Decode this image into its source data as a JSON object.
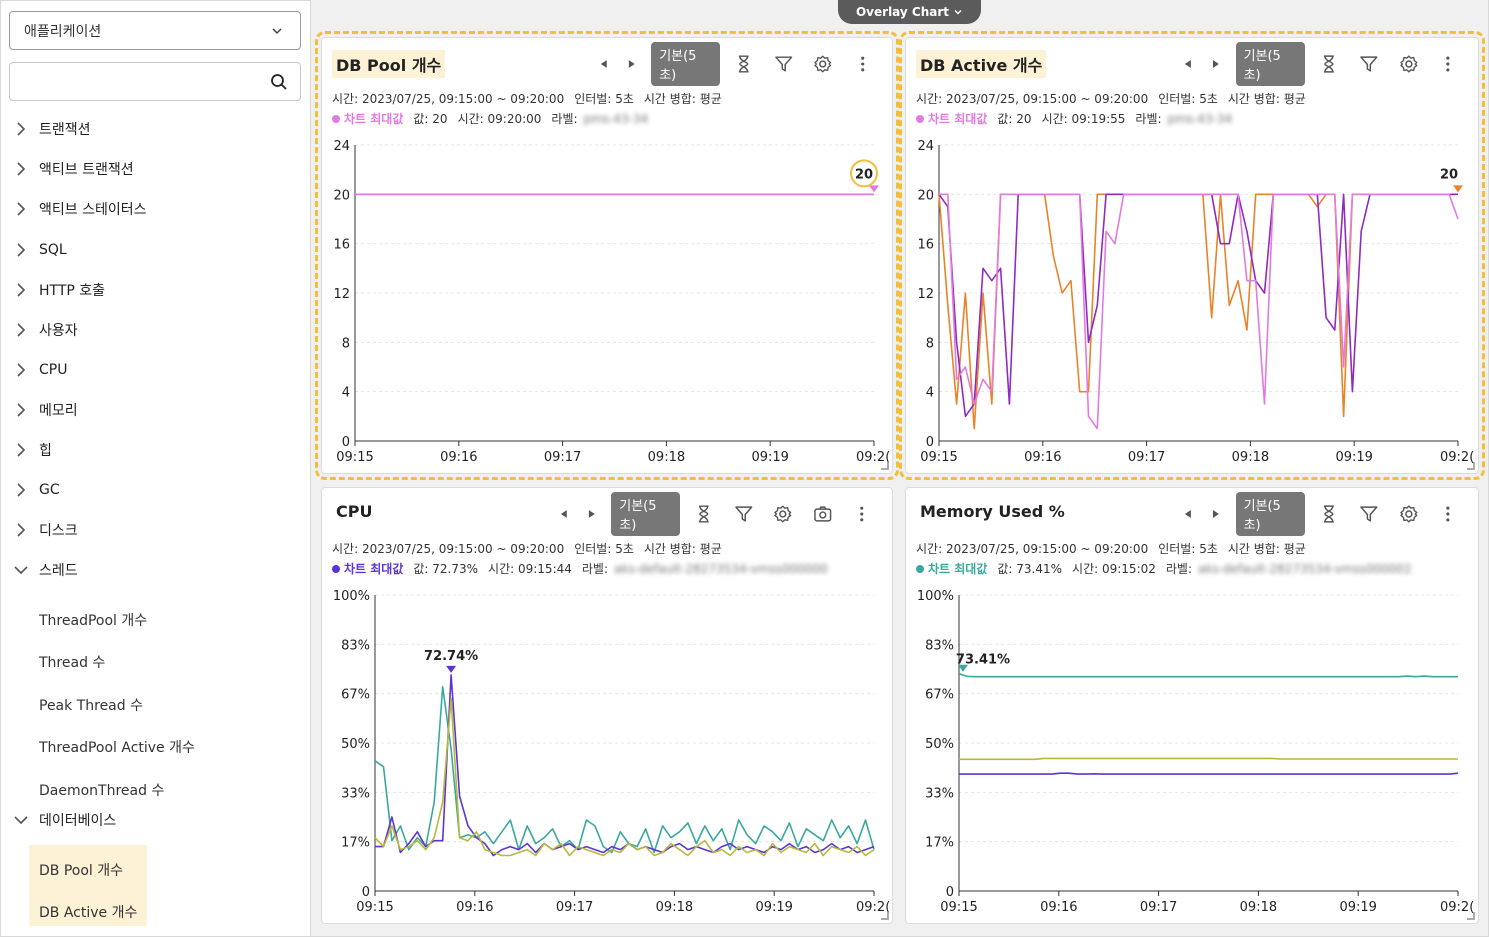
{
  "sidebar": {
    "app_select": "애플리케이션",
    "search_placeholder": "",
    "tree": [
      {
        "label": "트랜잭션",
        "expanded": false
      },
      {
        "label": "액티브 트랜잭션",
        "expanded": false
      },
      {
        "label": "액티브 스테이터스",
        "expanded": false
      },
      {
        "label": "SQL",
        "expanded": false
      },
      {
        "label": "HTTP 호출",
        "expanded": false
      },
      {
        "label": "사용자",
        "expanded": false
      },
      {
        "label": "CPU",
        "expanded": false
      },
      {
        "label": "메모리",
        "expanded": false
      },
      {
        "label": "힙",
        "expanded": false
      },
      {
        "label": "GC",
        "expanded": false
      },
      {
        "label": "디스크",
        "expanded": false
      },
      {
        "label": "스레드",
        "expanded": true
      },
      {
        "label": "데이터베이스",
        "expanded": true
      }
    ],
    "thread_children": [
      "ThreadPool 개수",
      "Thread 수",
      "Peak Thread 수",
      "ThreadPool Active 개수",
      "DaemonThread 수"
    ],
    "db_children": [
      "DB Pool 개수",
      "DB Active 개수"
    ]
  },
  "overlay_tab": "Overlay Chart",
  "colors": {
    "pink": "#e27be0",
    "purple": "#8e2cc2",
    "orange": "#e8832a",
    "indigo": "#5b34d6",
    "teal": "#3aa89f",
    "olive": "#b8b93a",
    "highlight": "#fdf1d6",
    "dash": "#f2bf3c"
  },
  "panels": [
    {
      "title": "DB Pool 개수",
      "badge": "기본(5초)",
      "info_time": "시간: 2023/07/25, 09:15:00 ~ 09:20:00",
      "info_interval": "인터벌: 5초",
      "info_merge": "시간 병합: 평균",
      "max_label": "차트 최대값",
      "max_value": "값: 20",
      "max_time": "시간: 09:20:00",
      "label_key": "라벨:",
      "label_val": "pms-43-34",
      "peak_text": "20"
    },
    {
      "title": "DB Active 개수",
      "badge": "기본(5초)",
      "info_time": "시간: 2023/07/25, 09:15:00 ~ 09:20:00",
      "info_interval": "인터벌: 5초",
      "info_merge": "시간 병합: 평균",
      "max_label": "차트 최대값",
      "max_value": "값: 20",
      "max_time": "시간: 09:19:55",
      "label_key": "라벨:",
      "label_val": "pms-43-34",
      "peak_text": "20"
    },
    {
      "title": "CPU",
      "badge": "기본(5초)",
      "info_time": "시간: 2023/07/25, 09:15:00 ~ 09:20:00",
      "info_interval": "인터벌: 5초",
      "info_merge": "시간 병합: 평균",
      "max_label": "차트 최대값",
      "max_value": "값: 72.73%",
      "max_time": "시간: 09:15:44",
      "label_key": "라벨:",
      "label_val": "aks-default-28273534-vmss000000",
      "peak_text": "72.74%"
    },
    {
      "title": "Memory Used %",
      "badge": "기본(5초)",
      "info_time": "시간: 2023/07/25, 09:15:00 ~ 09:20:00",
      "info_interval": "인터벌: 5초",
      "info_merge": "시간 병합: 평균",
      "max_label": "차트 최대값",
      "max_value": "값: 73.41%",
      "max_time": "시간: 09:15:02",
      "label_key": "라벨:",
      "label_val": "aks-default-28273534-vmss000002",
      "peak_text": "73.41%"
    }
  ],
  "chart_data": [
    {
      "type": "line",
      "x_ticks": [
        "09:15",
        "09:16",
        "09:17",
        "09:18",
        "09:19",
        "09:2("
      ],
      "y_ticks": [
        "0",
        "4",
        "8",
        "12",
        "16",
        "20",
        "24"
      ],
      "ylim": [
        0,
        24
      ],
      "series": [
        {
          "color": "#8e2cc2",
          "values": [
            20,
            20,
            20,
            20,
            20,
            20,
            20,
            20,
            20,
            20,
            20,
            20,
            20
          ]
        },
        {
          "color": "#e27be0",
          "values": [
            20,
            20,
            20,
            20,
            20,
            20,
            20,
            20,
            20,
            20,
            20,
            20,
            20
          ]
        }
      ]
    },
    {
      "type": "line",
      "x_ticks": [
        "09:15",
        "09:16",
        "09:17",
        "09:18",
        "09:19",
        "09:2("
      ],
      "y_ticks": [
        "0",
        "4",
        "8",
        "12",
        "16",
        "20",
        "24"
      ],
      "ylim": [
        0,
        24
      ],
      "series": [
        {
          "color": "#e8832a",
          "values": [
            20,
            11,
            3,
            12,
            1,
            12,
            3,
            20,
            20,
            20,
            20,
            20,
            20,
            15,
            12,
            13,
            4,
            4,
            20,
            20,
            20,
            20,
            20,
            20,
            20,
            20,
            20,
            20,
            20,
            20,
            20,
            10,
            20,
            11,
            13,
            9,
            20,
            20,
            20,
            20,
            20,
            20,
            20,
            19,
            20,
            20,
            2,
            20,
            20,
            20,
            20,
            20,
            20,
            20,
            20,
            20,
            20,
            20,
            20,
            20
          ]
        },
        {
          "color": "#8e2cc2",
          "values": [
            20,
            19,
            8,
            2,
            3,
            14,
            13,
            14,
            3,
            20,
            20,
            20,
            20,
            20,
            20,
            20,
            20,
            8,
            11,
            20,
            20,
            20,
            20,
            20,
            20,
            20,
            20,
            20,
            20,
            20,
            20,
            20,
            16,
            16,
            20,
            17,
            13,
            12,
            20,
            20,
            20,
            20,
            20,
            20,
            10,
            9,
            20,
            4,
            17,
            20,
            20,
            20,
            20,
            20,
            20,
            20,
            20,
            20,
            20,
            20
          ]
        },
        {
          "color": "#e27be0",
          "values": [
            20,
            20,
            5,
            6,
            3,
            5,
            4,
            20,
            20,
            20,
            20,
            20,
            20,
            20,
            20,
            20,
            20,
            2,
            1,
            17,
            16,
            20,
            20,
            20,
            20,
            20,
            20,
            20,
            20,
            20,
            20,
            20,
            20,
            20,
            20,
            13,
            13,
            3,
            20,
            20,
            20,
            20,
            20,
            20,
            20,
            20,
            6,
            20,
            20,
            20,
            20,
            20,
            20,
            20,
            20,
            20,
            20,
            20,
            20,
            18
          ]
        }
      ]
    },
    {
      "type": "line",
      "x_ticks": [
        "09:15",
        "09:16",
        "09:17",
        "09:18",
        "09:19",
        "09:2("
      ],
      "y_ticks": [
        "0",
        "17%",
        "33%",
        "50%",
        "67%",
        "83%",
        "100%"
      ],
      "ylim": [
        0,
        100
      ],
      "series": [
        {
          "color": "#3aa89f",
          "values": [
            44,
            42,
            17,
            22,
            14,
            18,
            15,
            30,
            69,
            48,
            18,
            19,
            18,
            20,
            16,
            20,
            24,
            14,
            22,
            16,
            18,
            21,
            15,
            17,
            14,
            24,
            22,
            15,
            13,
            20,
            16,
            15,
            21,
            13,
            22,
            18,
            20,
            23,
            16,
            22,
            17,
            21,
            14,
            24,
            19,
            16,
            22,
            20,
            17,
            23,
            15,
            21,
            19,
            17,
            24,
            18,
            22,
            16,
            24,
            14
          ]
        },
        {
          "color": "#5b34d6",
          "values": [
            15,
            15,
            25,
            13,
            16,
            20,
            15,
            17,
            17,
            73,
            32,
            22,
            18,
            16,
            12,
            14,
            15,
            14,
            16,
            13,
            16,
            14,
            15,
            16,
            14,
            15,
            14,
            13,
            15,
            14,
            16,
            14,
            15,
            14,
            13,
            15,
            16,
            14,
            15,
            14,
            13,
            15,
            16,
            14,
            15,
            14,
            13,
            15,
            14,
            16,
            14,
            15,
            13,
            14,
            16,
            14,
            15,
            13,
            14,
            15
          ]
        },
        {
          "color": "#b8b93a",
          "values": [
            18,
            15,
            22,
            14,
            15,
            17,
            14,
            18,
            30,
            65,
            18,
            17,
            20,
            14,
            13,
            12,
            12,
            13,
            14,
            12,
            16,
            14,
            16,
            12,
            15,
            14,
            13,
            12,
            14,
            13,
            16,
            14,
            15,
            12,
            13,
            16,
            14,
            12,
            15,
            17,
            13,
            14,
            12,
            15,
            13,
            14,
            12,
            16,
            13,
            15,
            14,
            13,
            16,
            12,
            15,
            14,
            13,
            15,
            12,
            14
          ]
        }
      ]
    },
    {
      "type": "line",
      "x_ticks": [
        "09:15",
        "09:16",
        "09:17",
        "09:18",
        "09:19",
        "09:2("
      ],
      "y_ticks": [
        "0",
        "17%",
        "33%",
        "50%",
        "67%",
        "83%",
        "100%"
      ],
      "ylim": [
        0,
        100
      ],
      "series": [
        {
          "color": "#3aa89f",
          "values": [
            73.41,
            72.5,
            72.4,
            72.4,
            72.4,
            72.4,
            72.4,
            72.4,
            72.4,
            72.4,
            72.4,
            72.4,
            72.4,
            72.4,
            72.4,
            72.4,
            72.4,
            72.4,
            72.4,
            72.4,
            72.4,
            72.4,
            72.4,
            72.4,
            72.4,
            72.4,
            72.4,
            72.4,
            72.4,
            72.4,
            72.4,
            72.4,
            72.4,
            72.4,
            72.4,
            72.4,
            72.4,
            72.4,
            72.4,
            72.4,
            72.4,
            72.4,
            72.4,
            72.4,
            72.4,
            72.4,
            72.4,
            72.4,
            72.4,
            72.4,
            72.4,
            72.4,
            72.4,
            72.6,
            72.4,
            72.6,
            72.4,
            72.4,
            72.4,
            72.4
          ]
        },
        {
          "color": "#b8b93a",
          "values": [
            44.5,
            44.5,
            44.5,
            44.5,
            44.5,
            44.5,
            44.5,
            44.5,
            44.5,
            44.5,
            44.8,
            44.8,
            44.8,
            44.8,
            44.8,
            44.8,
            44.8,
            44.8,
            44.8,
            44.8,
            44.8,
            44.8,
            44.8,
            44.8,
            44.8,
            44.8,
            44.8,
            44.8,
            44.8,
            44.8,
            44.8,
            44.8,
            44.8,
            44.8,
            44.8,
            44.8,
            44.8,
            44.8,
            44.6,
            44.6,
            44.6,
            44.6,
            44.6,
            44.6,
            44.6,
            44.6,
            44.6,
            44.6,
            44.6,
            44.6,
            44.6,
            44.6,
            44.6,
            44.6,
            44.6,
            44.6,
            44.6,
            44.6,
            44.6,
            44.6
          ]
        },
        {
          "color": "#5b34d6",
          "values": [
            39.5,
            39.5,
            39.5,
            39.5,
            39.5,
            39.5,
            39.5,
            39.5,
            39.5,
            39.5,
            39.5,
            39.5,
            39.8,
            39.8,
            39.5,
            39.5,
            39.6,
            39.5,
            39.5,
            39.5,
            39.5,
            39.5,
            39.5,
            39.5,
            39.5,
            39.5,
            39.5,
            39.5,
            39.5,
            39.5,
            39.5,
            39.5,
            39.5,
            39.5,
            39.5,
            39.5,
            39.5,
            39.5,
            39.5,
            39.5,
            39.5,
            39.5,
            39.5,
            39.5,
            39.5,
            39.5,
            39.5,
            39.5,
            39.5,
            39.5,
            39.5,
            39.5,
            39.5,
            39.5,
            39.5,
            39.5,
            39.5,
            39.5,
            39.5,
            39.8
          ]
        }
      ]
    }
  ]
}
